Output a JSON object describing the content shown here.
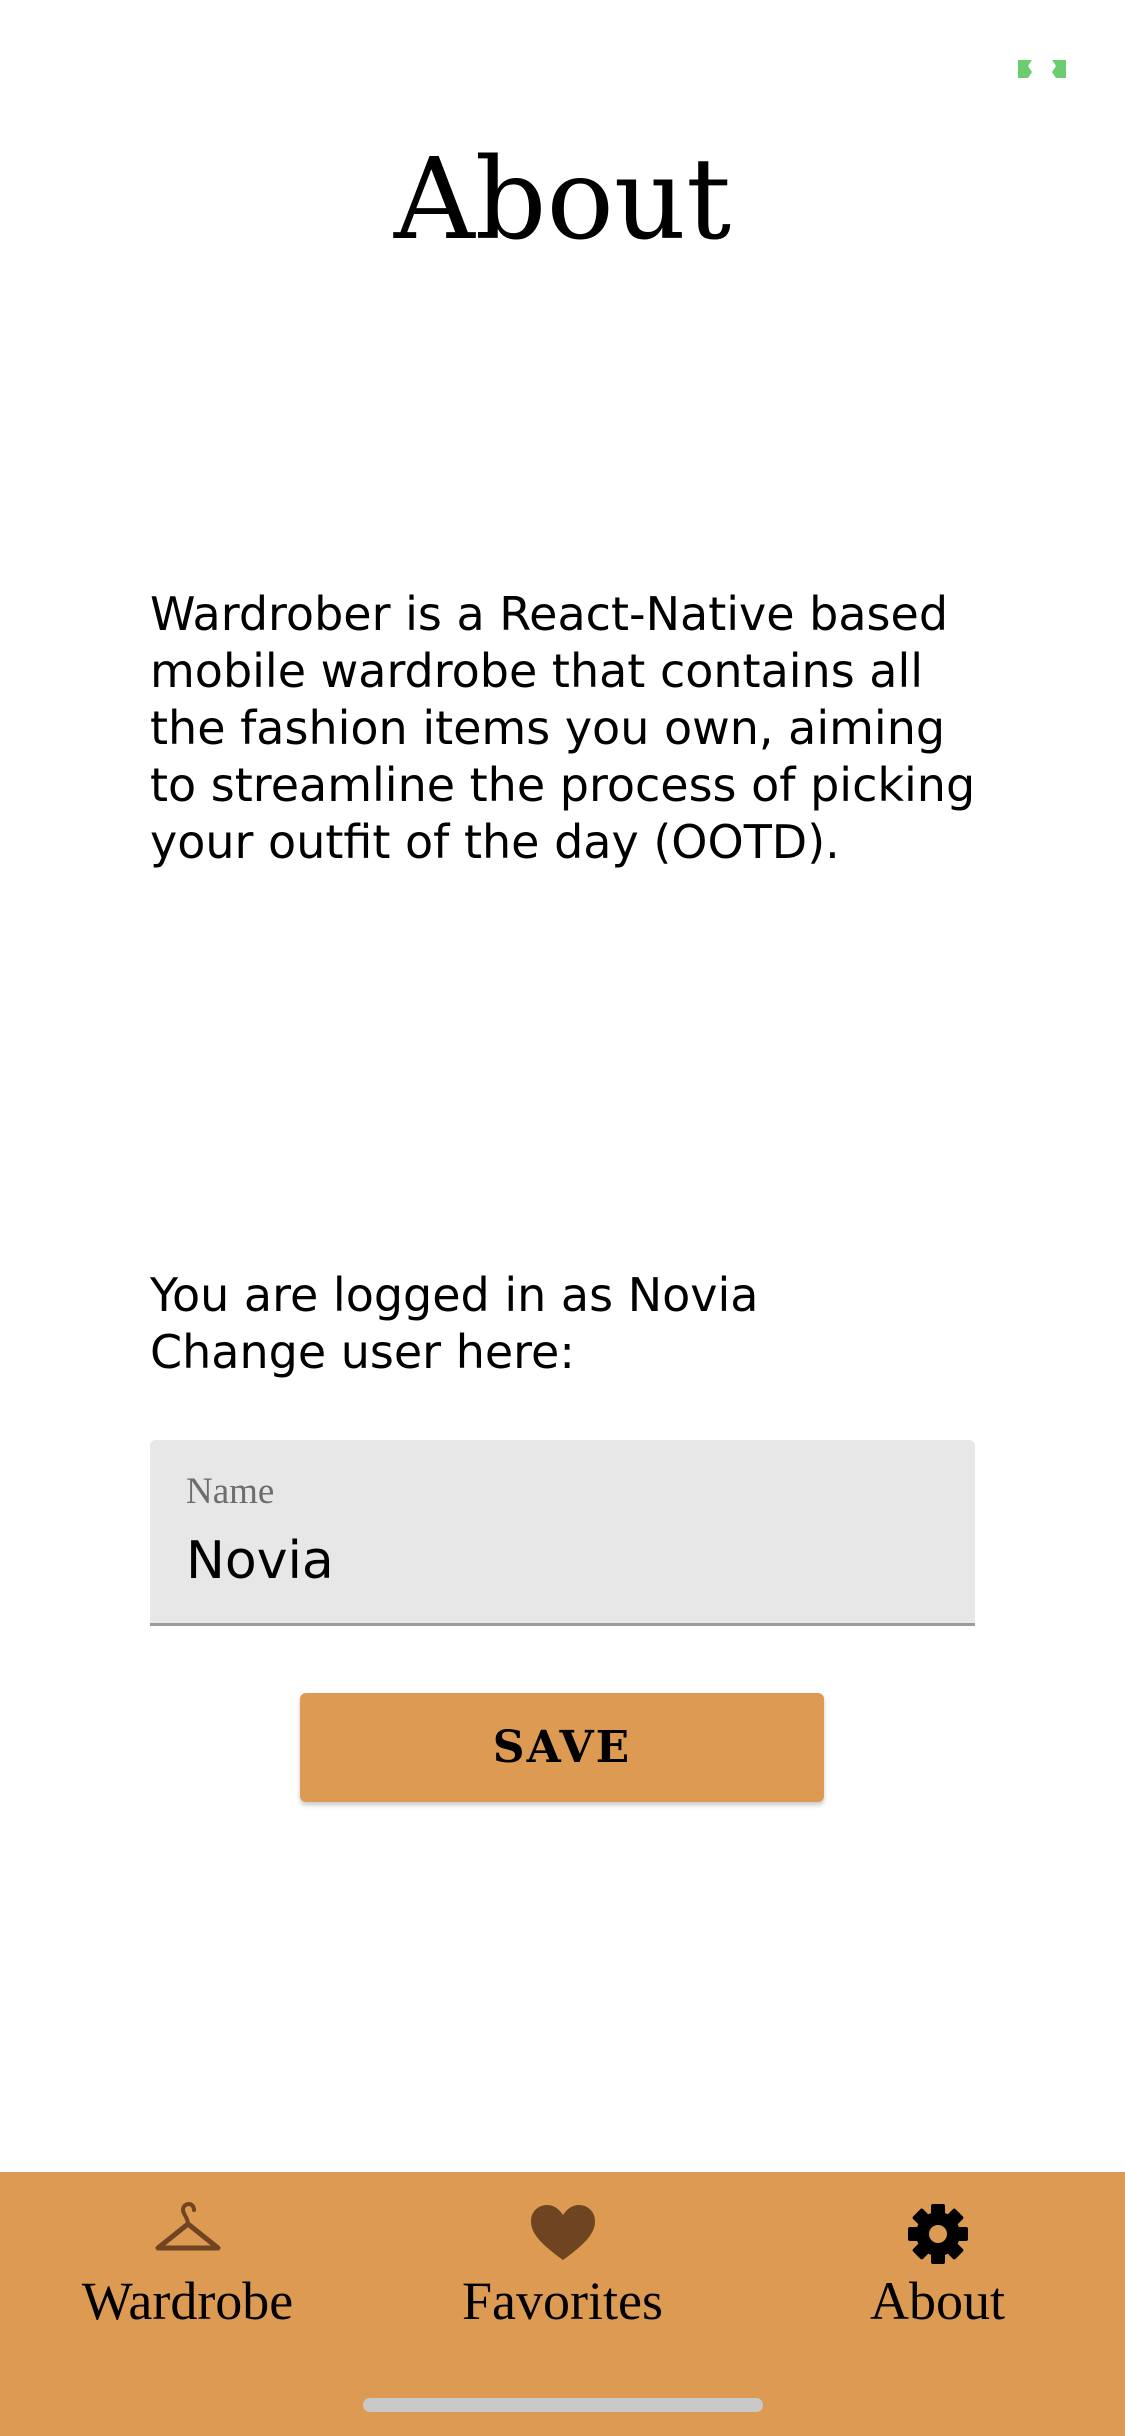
{
  "app": {
    "title": "About",
    "description": "Wardrober is a React-Native based mobile wardrobe that contains all the fashion items you own, aiming to streamline the process of picking your outfit of the day (OOTD).",
    "login_line": "You are logged in as Novia",
    "change_user_line": "Change user here:"
  },
  "form": {
    "name_label": "Name",
    "name_value": "Novia",
    "save_label": "SAVE"
  },
  "tabs": [
    {
      "label": "Wardrobe",
      "icon": "hanger-icon",
      "icon_color": "#6f4421"
    },
    {
      "label": "Favorites",
      "icon": "heart-icon",
      "icon_color": "#6f4421"
    },
    {
      "label": "About",
      "icon": "gear-icon",
      "icon_color": "#000000",
      "active": true
    }
  ],
  "colors": {
    "accent": "#dd9a52",
    "tab_icon_inactive": "#6f4421",
    "field_background": "#e7e7e7",
    "status_indicator": "#6ccd70"
  }
}
